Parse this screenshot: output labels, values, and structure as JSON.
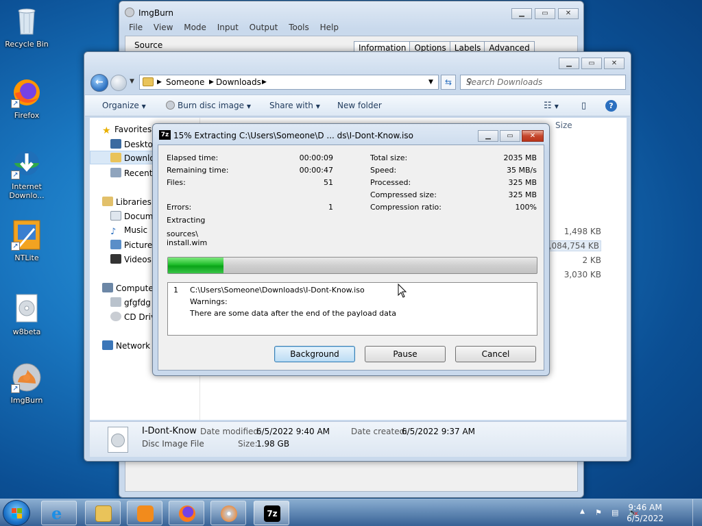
{
  "desktop": {
    "icons": [
      {
        "label": "Recycle Bin",
        "icon": "recycle-bin-icon"
      },
      {
        "label": "Firefox",
        "icon": "firefox-icon"
      },
      {
        "label": "Internet Downlo...",
        "icon": "internet-download-manager-icon"
      },
      {
        "label": "NTLite",
        "icon": "ntlite-icon"
      },
      {
        "label": "w8beta",
        "icon": "disc-image-icon"
      },
      {
        "label": "ImgBurn",
        "icon": "imgburn-icon"
      }
    ]
  },
  "imgburn": {
    "title": "ImgBurn",
    "menu": [
      "File",
      "View",
      "Mode",
      "Input",
      "Output",
      "Tools",
      "Help"
    ],
    "source_label": "Source",
    "tabs": [
      "Information",
      "Options",
      "Labels",
      "Advanced"
    ]
  },
  "explorer": {
    "breadcrumb": [
      "Someone",
      "Downloads"
    ],
    "search_placeholder": "Search Downloads",
    "toolbar": {
      "organize": "Organize",
      "burn": "Burn disc image",
      "share": "Share with",
      "new_folder": "New folder"
    },
    "nav": {
      "favorites": "Favorites",
      "desktop": "Desktop",
      "downloads": "Downlo",
      "recent": "Recent",
      "libraries": "Libraries",
      "documents": "Docum",
      "music": "Music",
      "pictures": "Pictures",
      "videos": "Videos",
      "computer": "Compute",
      "gfgfdg": "gfgfdg",
      "cd_drive": "CD Driv",
      "network": "Network"
    },
    "size_header": "Size",
    "sizes": [
      "1,498 KB",
      "2,084,754 KB",
      "2 KB",
      "3,030 KB"
    ],
    "details": {
      "name": "I-Dont-Know",
      "type": "Disc Image File",
      "date_modified_label": "Date modified:",
      "date_modified": "6/5/2022 9:40 AM",
      "date_created_label": "Date created:",
      "date_created": "6/5/2022 9:37 AM",
      "size_label": "Size:",
      "size": "1.98 GB"
    }
  },
  "sevenzip": {
    "app_icon": "7z",
    "title": "15% Extracting C:\\Users\\Someone\\D ... ds\\I-Dont-Know.iso",
    "left_stats": [
      {
        "label": "Elapsed time:",
        "value": "00:00:09"
      },
      {
        "label": "Remaining time:",
        "value": "00:00:47"
      },
      {
        "label": "Files:",
        "value": "51"
      }
    ],
    "errors": {
      "label": "Errors:",
      "value": "1"
    },
    "right_stats": [
      {
        "label": "Total size:",
        "value": "2035 MB"
      },
      {
        "label": "Speed:",
        "value": "35 MB/s"
      },
      {
        "label": "Processed:",
        "value": "325 MB"
      },
      {
        "label": "Compressed size:",
        "value": "325 MB"
      },
      {
        "label": "Compression ratio:",
        "value": "100%"
      }
    ],
    "status": "Extracting",
    "current_path": "sources\\",
    "current_file": "install.wim",
    "progress_percent": 15,
    "log": {
      "index": "1",
      "path": "C:\\Users\\Someone\\Downloads\\I-Dont-Know.iso",
      "warnings_label": "Warnings:",
      "message": "There are some data after the end of the payload data"
    },
    "buttons": {
      "background": "Background",
      "pause": "Pause",
      "cancel": "Cancel"
    }
  },
  "taskbar": {
    "items": [
      "internet-explorer-icon",
      "windows-explorer-icon",
      "media-player-icon",
      "firefox-icon",
      "imgburn-icon",
      "7zip-icon"
    ],
    "time": "9:46 AM",
    "date": "6/5/2022"
  },
  "colors": {
    "progress_green": "#1fbd2b",
    "close_red": "#c5472c",
    "desktop_blue": "#1a78c2"
  }
}
